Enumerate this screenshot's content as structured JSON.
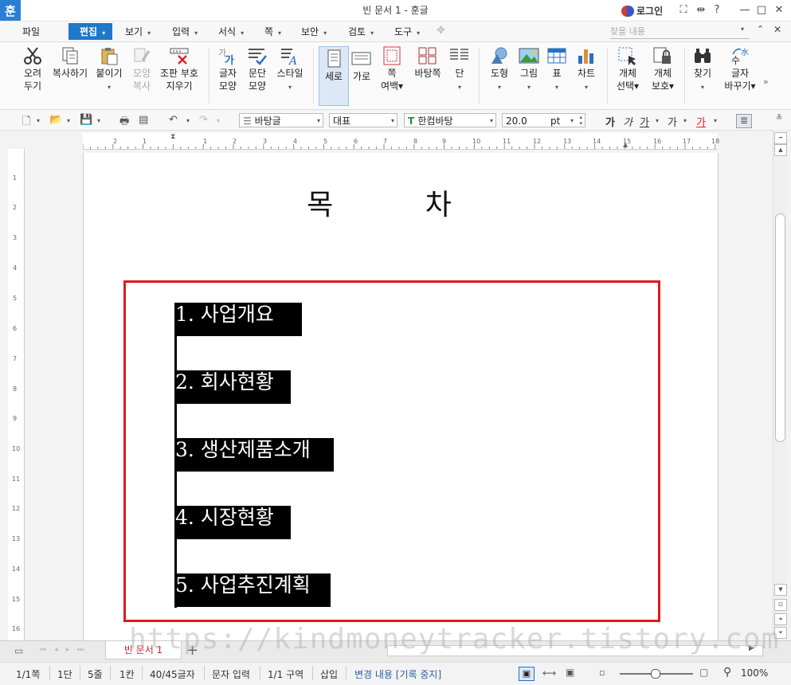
{
  "window": {
    "app_icon": "훈",
    "title": "빈 문서 1 - 훈글",
    "login": "로그인"
  },
  "title_controls": [
    "⛶",
    "⇹",
    "?",
    "—",
    "□",
    "✕"
  ],
  "menubar": {
    "items": [
      "파일",
      "편집",
      "보기",
      "입력",
      "서식",
      "쪽",
      "보안",
      "검토",
      "도구"
    ],
    "search_placeholder": "찾을 내용",
    "accent": "#1f78c8"
  },
  "ribbon": {
    "buttons": [
      {
        "id": "cut",
        "l1": "오려",
        "l2": "두기",
        "icon": "scissors-icon"
      },
      {
        "id": "copy",
        "l1": "복사하기",
        "l2": "",
        "icon": "copy-icon"
      },
      {
        "id": "paste",
        "l1": "붙이기",
        "l2": "▾",
        "icon": "paste-icon"
      },
      {
        "id": "format-copy",
        "l1": "모양",
        "l2": "복사",
        "icon": "format-painter-icon"
      },
      {
        "id": "clear-marks",
        "l1": "조판 부호",
        "l2": "지우기",
        "icon": "clear-marks-icon"
      },
      {
        "id": "char-shape",
        "l1": "글자",
        "l2": "모양",
        "icon": "char-shape-icon"
      },
      {
        "id": "para-shape",
        "l1": "문단",
        "l2": "모양",
        "icon": "para-shape-icon"
      },
      {
        "id": "style",
        "l1": "스타일",
        "l2": "▾",
        "icon": "style-icon"
      },
      {
        "id": "portrait",
        "l1": "세로",
        "l2": "",
        "icon": "portrait-icon"
      },
      {
        "id": "landscape",
        "l1": "가로",
        "l2": "",
        "icon": "landscape-icon"
      },
      {
        "id": "margin",
        "l1": "쪽",
        "l2": "여백▾",
        "icon": "page-margin-icon"
      },
      {
        "id": "tile",
        "l1": "바탕쪽",
        "l2": "",
        "icon": "tile-icon"
      },
      {
        "id": "columns",
        "l1": "단",
        "l2": "▾",
        "icon": "columns-icon"
      },
      {
        "id": "shape",
        "l1": "도형",
        "l2": "▾",
        "icon": "shape-icon"
      },
      {
        "id": "picture",
        "l1": "그림",
        "l2": "▾",
        "icon": "picture-icon"
      },
      {
        "id": "table",
        "l1": "표",
        "l2": "▾",
        "icon": "table-icon"
      },
      {
        "id": "chart",
        "l1": "차트",
        "l2": "▾",
        "icon": "chart-icon"
      },
      {
        "id": "obj-select",
        "l1": "개체",
        "l2": "선택▾",
        "icon": "object-select-icon"
      },
      {
        "id": "obj-protect",
        "l1": "개체",
        "l2": "보호▾",
        "icon": "object-protect-icon"
      },
      {
        "id": "find",
        "l1": "찾기",
        "l2": "▾",
        "icon": "binoculars-icon"
      },
      {
        "id": "replace",
        "l1": "글자",
        "l2": "바꾸기▾",
        "icon": "replace-char-icon"
      }
    ],
    "more": "»"
  },
  "format_toolbar": {
    "style_name": "바탕글",
    "font_lang": "대표",
    "font_name": "한컴바탕",
    "font_size": "20.0",
    "size_unit": "pt"
  },
  "document": {
    "title": "목 차",
    "toc": [
      "1. 사업개요",
      "2. 회사현황",
      "3. 생산제품소개",
      "4. 시장현황",
      "5. 사업추진계획"
    ],
    "highlight_color": "#e01919"
  },
  "ruler": {
    "h_ticks": [
      "2",
      "1",
      "1",
      "2",
      "3",
      "4",
      "5",
      "6",
      "7",
      "8",
      "9",
      "10",
      "11",
      "12",
      "13",
      "14",
      "15",
      "16",
      "17",
      "18"
    ],
    "v_ticks": [
      "1",
      "2",
      "3",
      "4",
      "5",
      "6",
      "7",
      "8",
      "9",
      "10",
      "11",
      "12",
      "13",
      "14",
      "15",
      "16"
    ]
  },
  "tabs": {
    "doc_tab": "빈 문서 1",
    "add": "+"
  },
  "watermark": "https://kindmoneytracker.tistory.com",
  "statusbar": {
    "page": "1/1쪽",
    "col": "1단",
    "line": "5줄",
    "char": "1칸",
    "count": "40/45글자",
    "mode": "문자 입력",
    "section": "1/1 구역",
    "insert": "삽입",
    "track": "변경 내용 [기록 중지]",
    "zoom": "100%"
  }
}
